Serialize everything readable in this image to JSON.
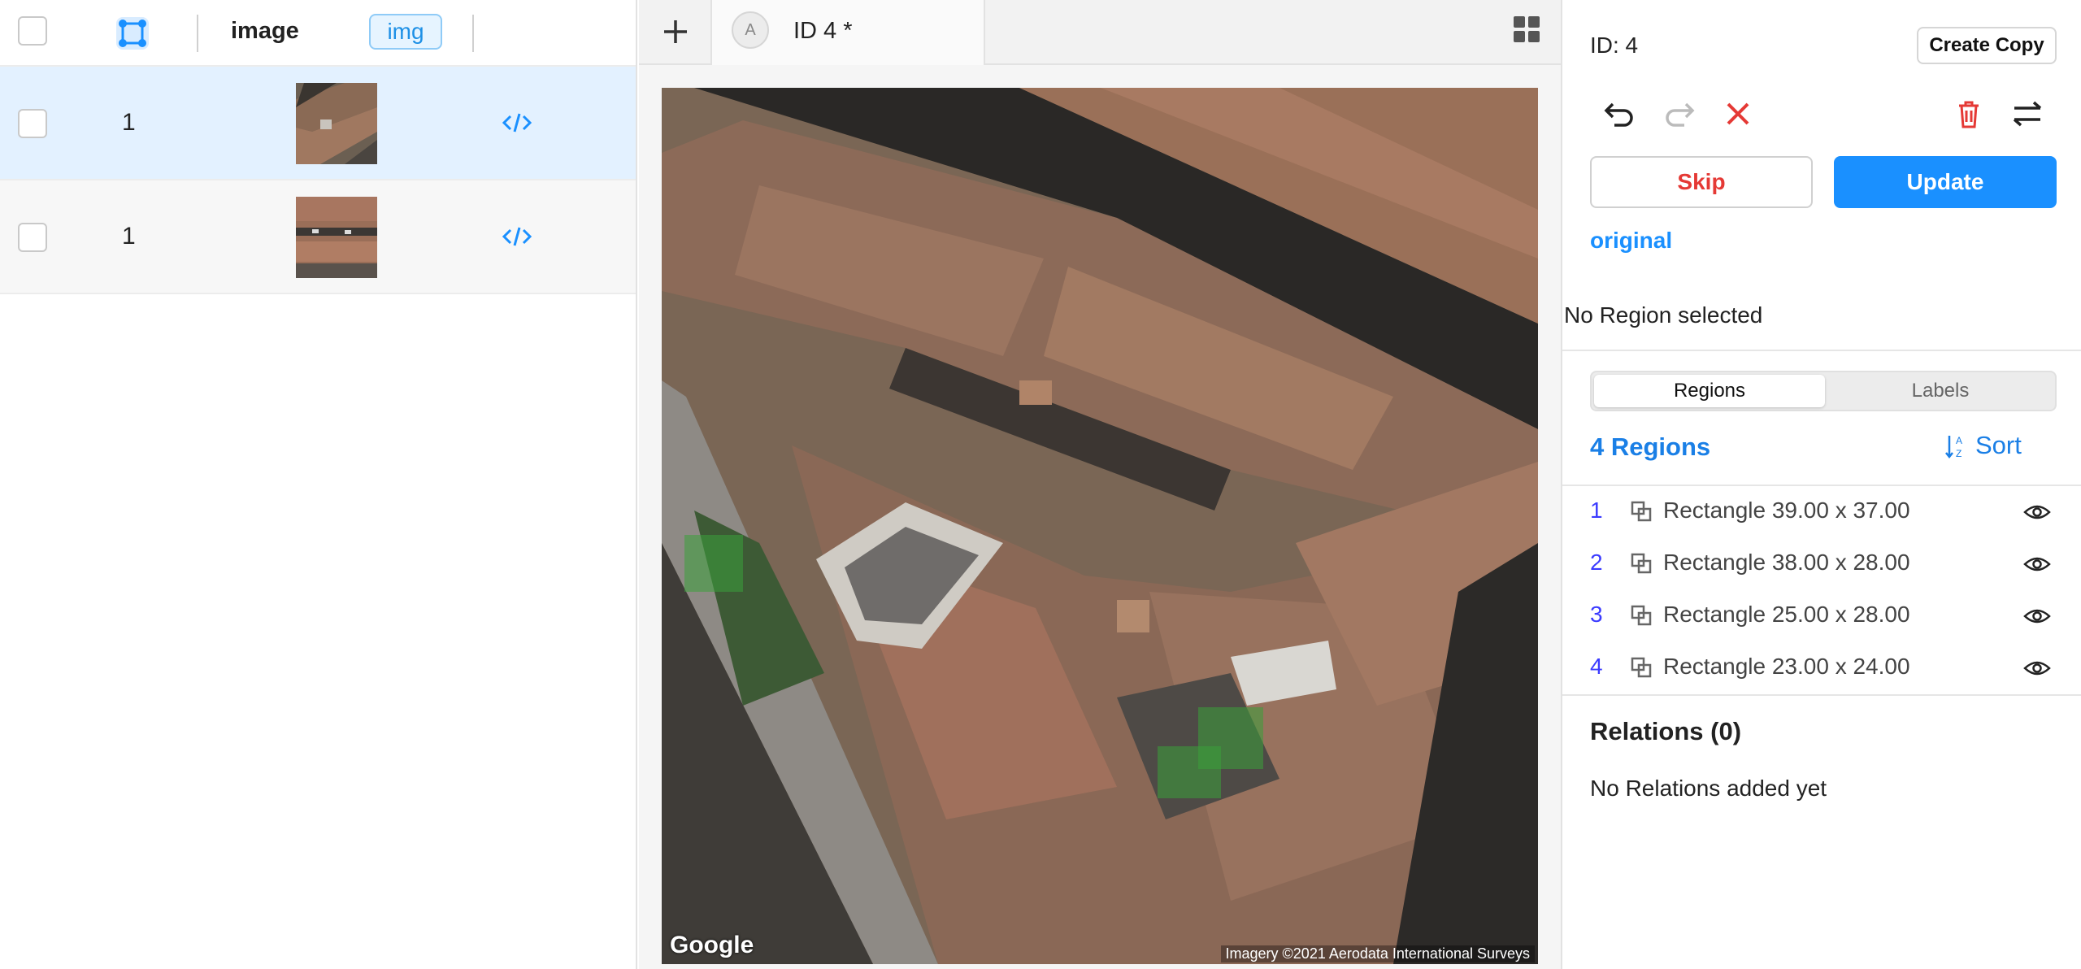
{
  "list": {
    "header": {
      "column_label": "image",
      "tag_label": "img"
    },
    "rows": [
      {
        "number": "1",
        "selected": true
      },
      {
        "number": "1",
        "selected": false
      }
    ]
  },
  "center": {
    "tab_avatar": "A",
    "tab_title": "ID 4 *",
    "map_logo": "Google",
    "map_attribution": "Imagery ©2021 Aerodata International Surveys"
  },
  "right": {
    "id_label": "ID: 4",
    "create_copy_label": "Create Copy",
    "skip_label": "Skip",
    "update_label": "Update",
    "original_label": "original",
    "no_region_label": "No Region selected",
    "tabs": {
      "regions": "Regions",
      "labels": "Labels"
    },
    "regions_count_label": "4 Regions",
    "sort_label": "Sort",
    "regions": [
      {
        "index": "1",
        "label": "Rectangle 39.00 x 37.00"
      },
      {
        "index": "2",
        "label": "Rectangle 38.00 x 28.00"
      },
      {
        "index": "3",
        "label": "Rectangle 25.00 x 28.00"
      },
      {
        "index": "4",
        "label": "Rectangle 23.00 x 24.00"
      }
    ],
    "relations_title": "Relations (0)",
    "relations_empty": "No Relations added yet"
  },
  "colors": {
    "accent": "#1a90ff",
    "skip_text": "#e53935",
    "selected_row_bg": "#e3f1ff",
    "region_fill": "#3aa03a"
  }
}
